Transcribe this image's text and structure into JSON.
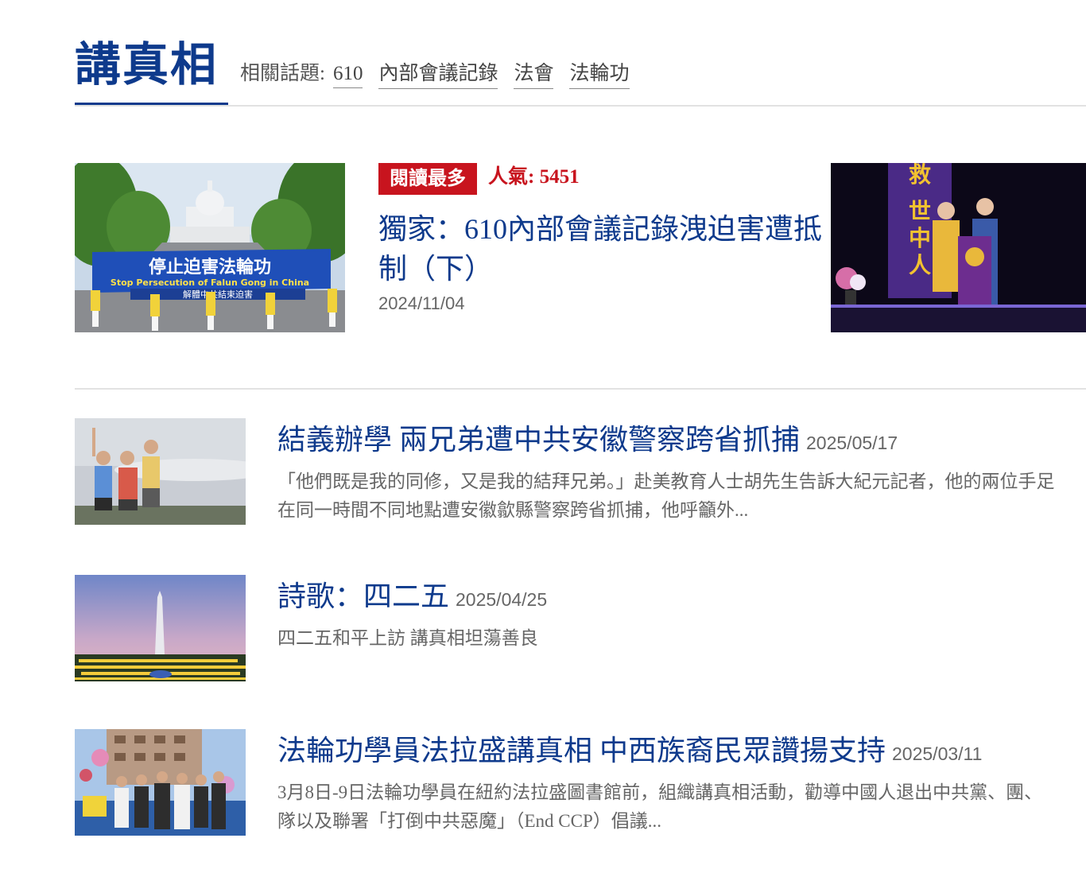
{
  "header": {
    "title": "講真相",
    "topics_label": "相關話題:",
    "topics": [
      "610",
      "內部會議記錄",
      "法會",
      "法輪功"
    ]
  },
  "featured": {
    "badge": "閱讀最多",
    "popularity": "人氣: 5451",
    "title": "獨家：610內部會議記錄洩迫害遭抵制（下）",
    "date": "2024/11/04",
    "left_image": {
      "banner_main": "停止迫害法輪功",
      "banner_sub": "Stop Persecution of Falun Gong in China",
      "banner_below": "解體中共結束迫害"
    },
    "right_image": {
      "banner_chars": [
        "救",
        "世",
        "中",
        "人"
      ]
    }
  },
  "articles": [
    {
      "title": "結義辦學 兩兄弟遭中共安徽警察跨省抓捕",
      "date": "2025/05/17",
      "summary": "「他們既是我的同修，又是我的結拜兄弟。」赴美教育人士胡先生告訴大紀元記者，他的兩位手足在同一時間不同地點遭安徽歙縣警察跨省抓捕，他呼籲外..."
    },
    {
      "title": "詩歌：四二五",
      "date": "2025/04/25",
      "summary": "四二五和平上訪 講真相坦蕩善良"
    },
    {
      "title": "法輪功學員法拉盛講真相 中西族裔民眾讚揚支持",
      "date": "2025/03/11",
      "summary": "3月8日-9日法輪功學員在紐約法拉盛圖書館前，組織講真相活動，勸導中國人退出中共黨、團、隊以及聯署「打倒中共惡魔」（End CCP）倡議..."
    }
  ],
  "colors": {
    "brand_blue": "#0e3a8c",
    "badge_red": "#c8141e",
    "text_gray": "#666666",
    "rule_gray": "#e2e2e2"
  }
}
